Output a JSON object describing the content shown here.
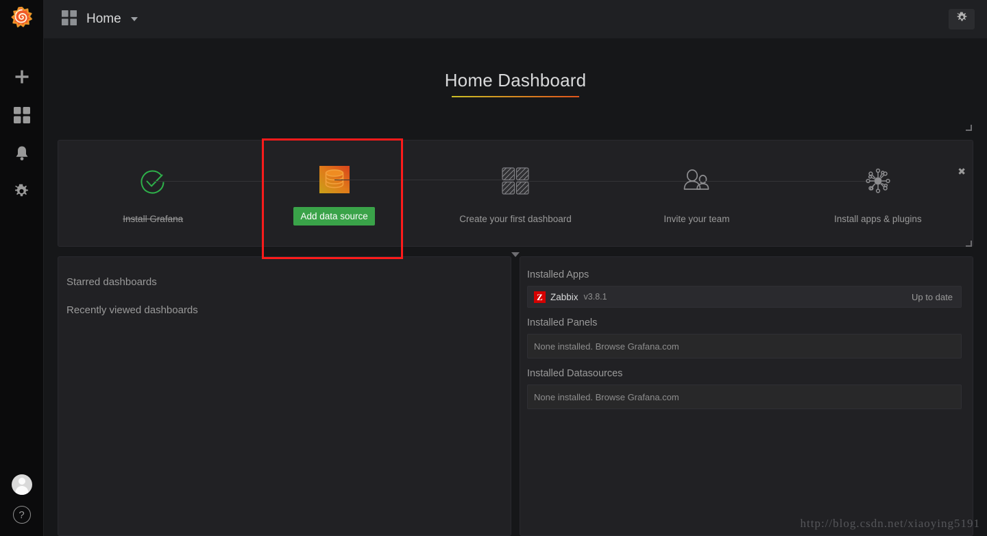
{
  "sidebar": {
    "brand_icon": "grafana-logo",
    "items": [
      {
        "icon": "plus-icon",
        "name": "create"
      },
      {
        "icon": "dashboards-icon",
        "name": "dashboards"
      },
      {
        "icon": "bell-icon",
        "name": "alerting"
      },
      {
        "icon": "gear-icon",
        "name": "configuration"
      }
    ],
    "bottom": [
      {
        "icon": "avatar-icon",
        "name": "user-profile"
      },
      {
        "icon": "question-icon",
        "name": "help",
        "glyph": "?"
      }
    ]
  },
  "topbar": {
    "home_icon": "dashboards-icon",
    "home_label": "Home",
    "dropdown_icon": "chevron-down-icon",
    "settings_icon": "gear-icon"
  },
  "dashboard": {
    "title": "Home Dashboard"
  },
  "getting_started": {
    "close_icon": "close-icon",
    "close_glyph": "✖",
    "collapse_icon": "caret-down-icon",
    "steps": [
      {
        "icon": "check-circle-icon",
        "label": "Install Grafana",
        "done": true,
        "cta": null
      },
      {
        "icon": "database-icon",
        "label": null,
        "done": false,
        "cta": "Add data source"
      },
      {
        "icon": "dashboard-grid-icon",
        "label": "Create your first dashboard",
        "done": false,
        "cta": null
      },
      {
        "icon": "team-icon",
        "label": "Invite your team",
        "done": false,
        "cta": null
      },
      {
        "icon": "plugins-hub-icon",
        "label": "Install apps & plugins",
        "done": false,
        "cta": null
      }
    ]
  },
  "left_panel": {
    "links": [
      {
        "label": "Starred dashboards"
      },
      {
        "label": "Recently viewed dashboards"
      }
    ]
  },
  "right_panel": {
    "sections": [
      {
        "heading": "Installed Apps",
        "rows": [
          {
            "logo": "zabbix-logo",
            "logo_letter": "Z",
            "name": "Zabbix",
            "version": "v3.8.1",
            "state": "Up to date",
            "empty": false
          }
        ]
      },
      {
        "heading": "Installed Panels",
        "rows": [
          {
            "empty": true,
            "text": "None installed. Browse Grafana.com"
          }
        ]
      },
      {
        "heading": "Installed Datasources",
        "rows": [
          {
            "empty": true,
            "text": "None installed. Browse Grafana.com"
          }
        ]
      }
    ]
  },
  "annotation": {
    "highlight_color": "#fd1b1b",
    "watermark": "http://blog.csdn.net/xiaoying5191"
  },
  "colors": {
    "page_bg": "#161719",
    "panel_bg": "#212124",
    "topbar_bg": "#1f2023",
    "rail_bg": "#0b0b0c",
    "accent_green": "#3aa349",
    "zabbix_red": "#d40000",
    "title_gradient_from": "#ccc026",
    "title_gradient_to": "#e0541c"
  }
}
